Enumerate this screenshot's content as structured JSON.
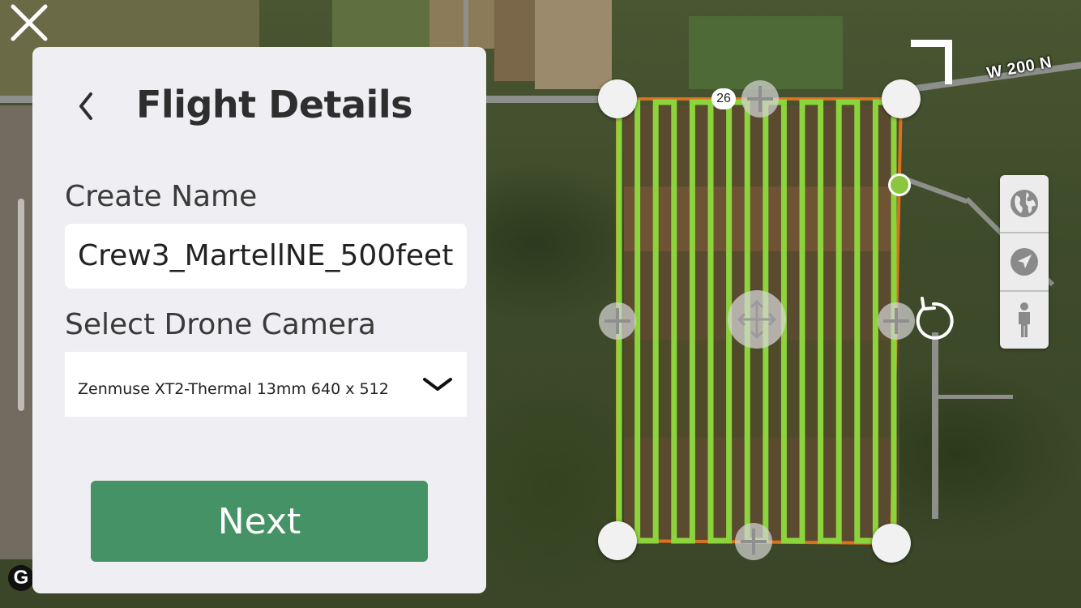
{
  "panel": {
    "title": "Flight Details",
    "create_name_label": "Create Name",
    "name_value": "Crew3_MartellNE_500feet",
    "camera_label": "Select Drone Camera",
    "camera_value": "Zenmuse XT2-Thermal 13mm 640 x 512",
    "next_label": "Next"
  },
  "map": {
    "road_label": "W 200 N",
    "waypoint_count": "26",
    "path_color": "#8cd43c",
    "boundary_color": "#d9731e",
    "start_point_color": "#8cc63f"
  },
  "controls": {
    "icons": [
      "globe-icon",
      "location-arrow-icon",
      "person-icon"
    ]
  },
  "colors": {
    "accent": "#449265",
    "panel_bg": "#efeff3"
  }
}
